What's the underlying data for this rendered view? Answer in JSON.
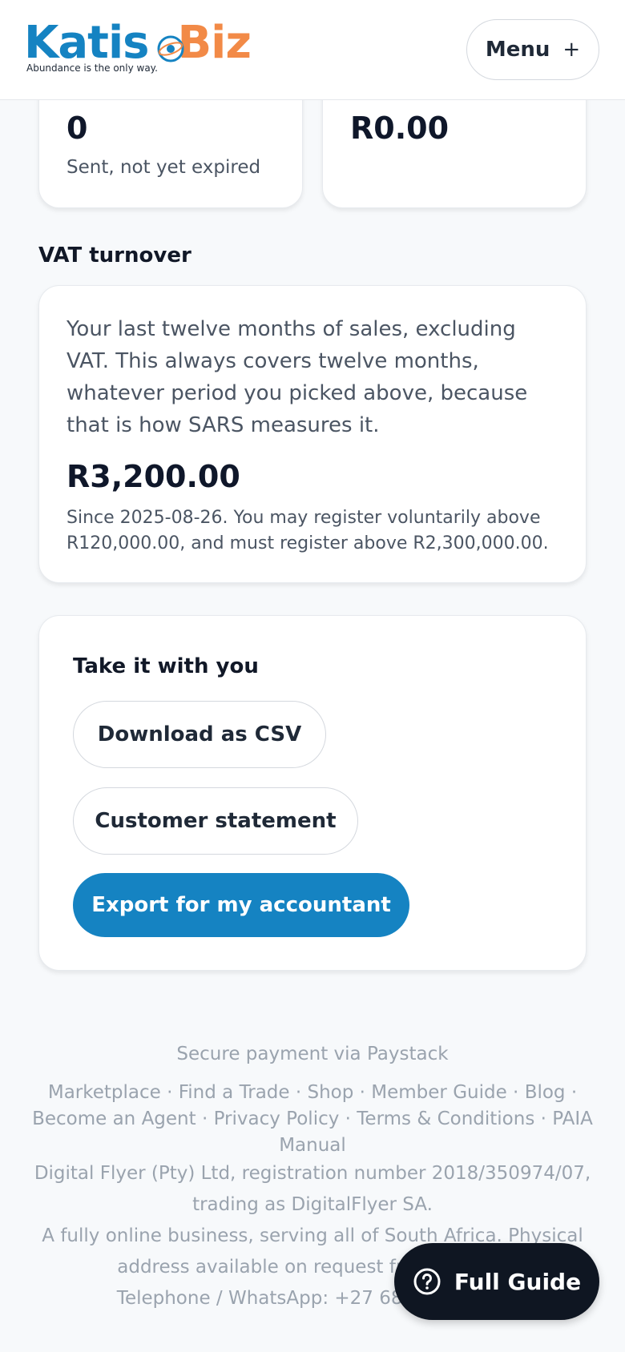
{
  "header": {
    "logo_part1": "Katis",
    "logo_part2": "Biz",
    "logo_tagline": "Abundance is the only way.",
    "menu_label": "Menu",
    "menu_icon": "+"
  },
  "stats": [
    {
      "value": "0",
      "label": "Sent, not yet expired"
    },
    {
      "value": "R0.00"
    }
  ],
  "vat": {
    "title": "VAT turnover",
    "description": "Your last twelve months of sales, excluding VAT. This always covers twelve months, whatever period you picked above, because that is how SARS measures it.",
    "amount": "R3,200.00",
    "note": "Since 2025-08-26. You may register voluntarily above R120,000.00, and must register above R2,300,000.00."
  },
  "take": {
    "title": "Take it with you",
    "download_csv": "Download as CSV",
    "customer_statement": "Customer statement",
    "export_accountant": "Export for my accountant"
  },
  "footer": {
    "payment": "Secure payment via Paystack",
    "links": [
      "Marketplace",
      "Find a Trade",
      "Shop",
      "Member Guide",
      "Blog",
      "Become an Agent",
      "Privacy Policy",
      "Terms & Conditions",
      "PAIA Manual"
    ],
    "separator": " · ",
    "company": "Digital Flyer (Pty) Ltd, registration number 2018/350974/07, trading as DigitalFlyer SA.",
    "online": "A fully online business, serving all of South Africa. Physical address available on request from info@di",
    "phone": "Telephone / WhatsApp: +27 68 870 7434 ·"
  },
  "guide": {
    "label": "Full Guide"
  },
  "colors": {
    "brand_blue": "#1583c2",
    "brand_orange": "#f28a47",
    "dark": "#0f1622"
  }
}
